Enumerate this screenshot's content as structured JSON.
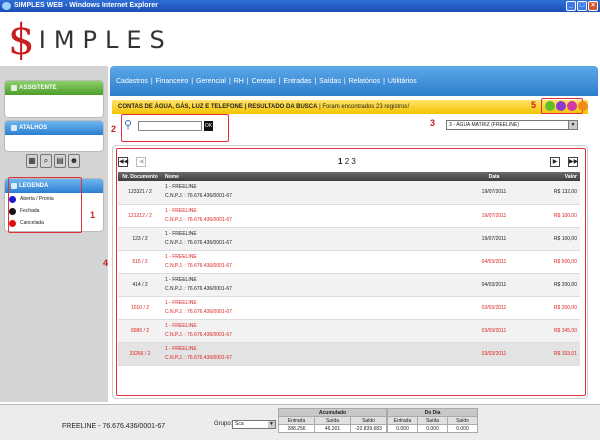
{
  "window": {
    "title": "SIMPLES WEB - Windows Internet Explorer"
  },
  "logo": {
    "mark": "$",
    "word": "IMPLES"
  },
  "menu": [
    "Cadastros",
    "Financeiro",
    "Gerencial",
    "RH",
    "Cereais",
    "Entradas",
    "Saídas",
    "Relatórios",
    "Utilitários"
  ],
  "sidebar": {
    "assistente": "ASSISTENTE",
    "atalhos": "ATALHOS",
    "legenda": {
      "title": "LEGENDA",
      "items": [
        {
          "label": "Aberta / Pronta",
          "color": "#1a1acc"
        },
        {
          "label": "Fechada",
          "color": "#111111"
        },
        {
          "label": "Cancelada",
          "color": "#dd1111"
        }
      ]
    }
  },
  "markers": [
    "1",
    "2",
    "3",
    "4",
    "5"
  ],
  "banner": {
    "title": "CONTAS DE ÁGUA, GÁS, LUZ E TELEFONE | RESULTADO DA BUSCA",
    "count_text": "| Foram encontrados 23 registros!"
  },
  "search": {
    "value": "",
    "ok_label": "OK"
  },
  "company_select": {
    "value": "3 - ÁGUA MATRIZ (FREELINE)"
  },
  "pager": {
    "first": "◀◀",
    "prev": "◀",
    "next": "▶",
    "last": "▶▶",
    "current": "1",
    "others": "2 3"
  },
  "table": {
    "columns": [
      "Nr. Documento",
      "Nome",
      "Data",
      "Valor"
    ],
    "rows": [
      {
        "doc": "123321 / 2",
        "name": "1 - FREELINE",
        "cnpj": "C.N.P.J. : 76.676.436/0001-67",
        "date": "19/07/2011",
        "value": "R$ 132,00",
        "status": "black"
      },
      {
        "doc": "121212 / 2",
        "name": "1 - FREELINE",
        "cnpj": "C.N.P.J. : 76.676.436/0001-67",
        "date": "19/07/2011",
        "value": "R$ 100,00",
        "status": "red"
      },
      {
        "doc": "123 / 2",
        "name": "1 - FREELINE",
        "cnpj": "C.N.P.J. : 76.676.436/0001-67",
        "date": "19/07/2011",
        "value": "R$ 100,00",
        "status": "black"
      },
      {
        "doc": "515 / 2",
        "name": "1 - FREELINE",
        "cnpj": "C.N.P.J. : 76.676.436/0001-67",
        "date": "04/03/2011",
        "value": "R$ 500,00",
        "status": "red"
      },
      {
        "doc": "414 / 2",
        "name": "1 - FREELINE",
        "cnpj": "C.N.P.J. : 76.676.436/0001-67",
        "date": "04/03/2011",
        "value": "R$ 200,00",
        "status": "black"
      },
      {
        "doc": "1010 / 2",
        "name": "1 - FREELINE",
        "cnpj": "C.N.P.J. : 76.676.436/0001-67",
        "date": "03/03/2011",
        "value": "R$ 200,00",
        "status": "red"
      },
      {
        "doc": "8989 / 2",
        "name": "1 - FREELINE",
        "cnpj": "C.N.P.J. : 76.676.436/0001-67",
        "date": "03/03/2011",
        "value": "R$ 345,00",
        "status": "red"
      },
      {
        "doc": "33266 / 2",
        "name": "1 - FREELINE",
        "cnpj": "C.N.P.J. : 76.676.436/0001-67",
        "date": "03/03/2011",
        "value": "R$ 333,01",
        "status": "red"
      }
    ]
  },
  "footer": {
    "company": "FREELINE - 76.676.436/0001-67",
    "grupo_label": "Grupo:",
    "grupo_value": "Sca",
    "acumulado": {
      "title": "Acumulado",
      "headers": [
        "Entrada",
        "Saída",
        "Saldo"
      ],
      "values": [
        "288.256",
        "46.301",
        "-22.839.683"
      ]
    },
    "dodia": {
      "title": "Do Dia",
      "headers": [
        "Entrada",
        "Saída",
        "Saldo"
      ],
      "values": [
        "0.000",
        "0.000",
        "0.000"
      ]
    }
  }
}
